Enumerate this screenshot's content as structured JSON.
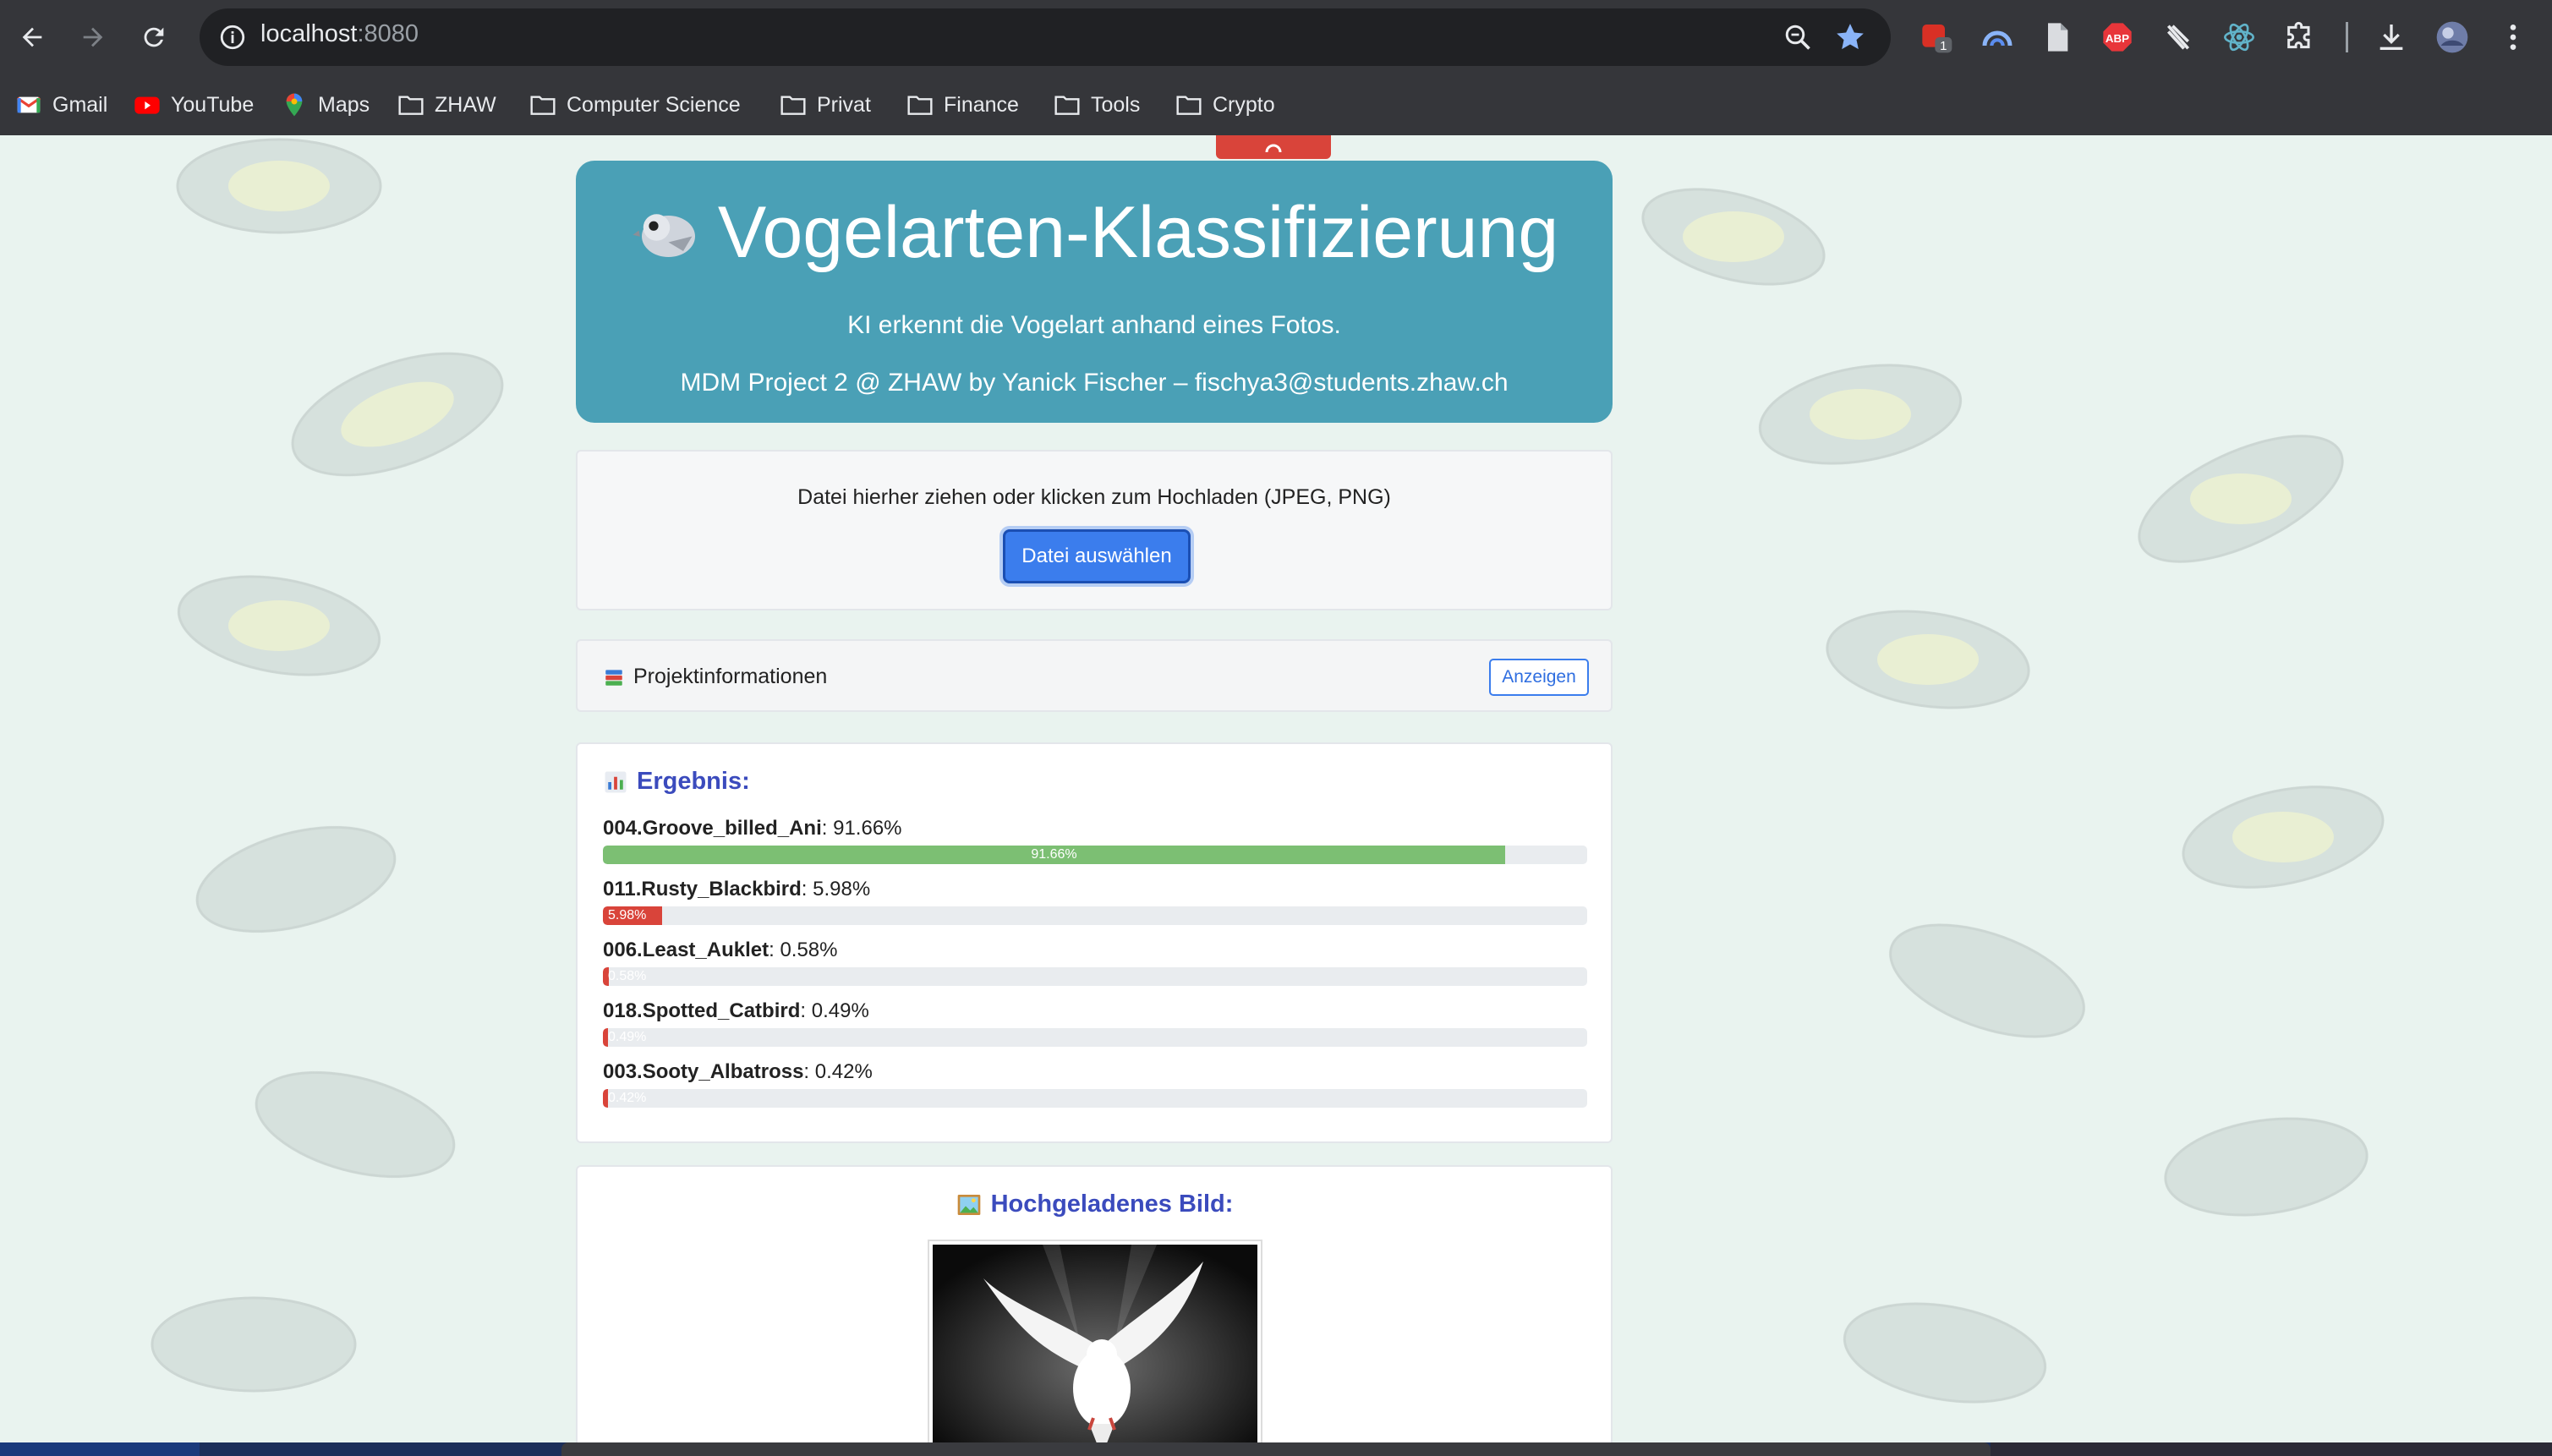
{
  "browser": {
    "url_host": "localhost",
    "url_port": ":8080",
    "extension_badge": "1",
    "bookmarks": [
      {
        "label": "Gmail",
        "icon": "gmail-icon"
      },
      {
        "label": "YouTube",
        "icon": "youtube-icon"
      },
      {
        "label": "Maps",
        "icon": "maps-icon"
      },
      {
        "label": "ZHAW",
        "icon": "folder-icon"
      },
      {
        "label": "Computer Science",
        "icon": "folder-icon"
      },
      {
        "label": "Privat",
        "icon": "folder-icon"
      },
      {
        "label": "Finance",
        "icon": "folder-icon"
      },
      {
        "label": "Tools",
        "icon": "folder-icon"
      },
      {
        "label": "Crypto",
        "icon": "folder-icon"
      }
    ]
  },
  "header": {
    "title": "Vogelarten-Klassifizierung",
    "subtitle": "KI erkennt die Vogelart anhand eines Fotos.",
    "credit": "MDM Project 2 @ ZHAW by Yanick Fischer – fischya3@students.zhaw.ch"
  },
  "upload": {
    "hint": "Datei hierher ziehen oder klicken zum Hochladen (JPEG, PNG)",
    "button": "Datei auswählen"
  },
  "project_info": {
    "label": "Projektinformationen",
    "button": "Anzeigen"
  },
  "results": {
    "title": "Ergebnis:",
    "predictions": [
      {
        "name": "004.Groove_billed_Ani",
        "percent_text": ": 91.66%",
        "bar_label": "91.66%",
        "value": 91.66,
        "color": "#7cbf73"
      },
      {
        "name": "011.Rusty_Blackbird",
        "percent_text": ": 5.98%",
        "bar_label": "5.98%",
        "value": 5.98,
        "color": "#d9443a"
      },
      {
        "name": "006.Least_Auklet",
        "percent_text": ": 0.58%",
        "bar_label": "0.58%",
        "value": 0.58,
        "color": "#d9443a"
      },
      {
        "name": "018.Spotted_Catbird",
        "percent_text": ": 0.49%",
        "bar_label": "0.49%",
        "value": 0.49,
        "color": "#d9443a"
      },
      {
        "name": "003.Sooty_Albatross",
        "percent_text": ": 0.42%",
        "bar_label": "0.42%",
        "value": 0.42,
        "color": "#d9443a"
      }
    ]
  },
  "image_section": {
    "title": "Hochgeladenes Bild:"
  },
  "colors": {
    "header_bg": "#4aa0b6",
    "primary_button": "#3b7ded",
    "heading_blue": "#3b4bbd",
    "success_bar": "#7cbf73",
    "danger_bar": "#d9443a"
  }
}
